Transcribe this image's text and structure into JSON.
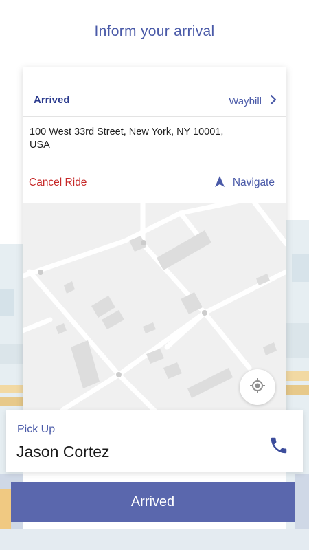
{
  "headline": "Inform your arrival",
  "trip": {
    "status_label": "Arrived",
    "waybill_label": "Waybill",
    "waybill_icon": "chevron-right-icon",
    "address_line1": "100 West 33rd Street, New York, NY 10001,",
    "address_line2": "USA",
    "cancel_label": "Cancel Ride",
    "navigate_label": "Navigate",
    "navigate_icon": "navigation-arrow-icon"
  },
  "map": {
    "locate_icon": "my-location-icon"
  },
  "pickup": {
    "label": "Pick Up",
    "name": "Jason Cortez",
    "call_icon": "phone-icon"
  },
  "action": {
    "label": "Arrived"
  },
  "colors": {
    "accent": "#4a5aa8",
    "status": "#2b3b8e",
    "cancel": "#c62828",
    "button": "#5a67ad"
  }
}
